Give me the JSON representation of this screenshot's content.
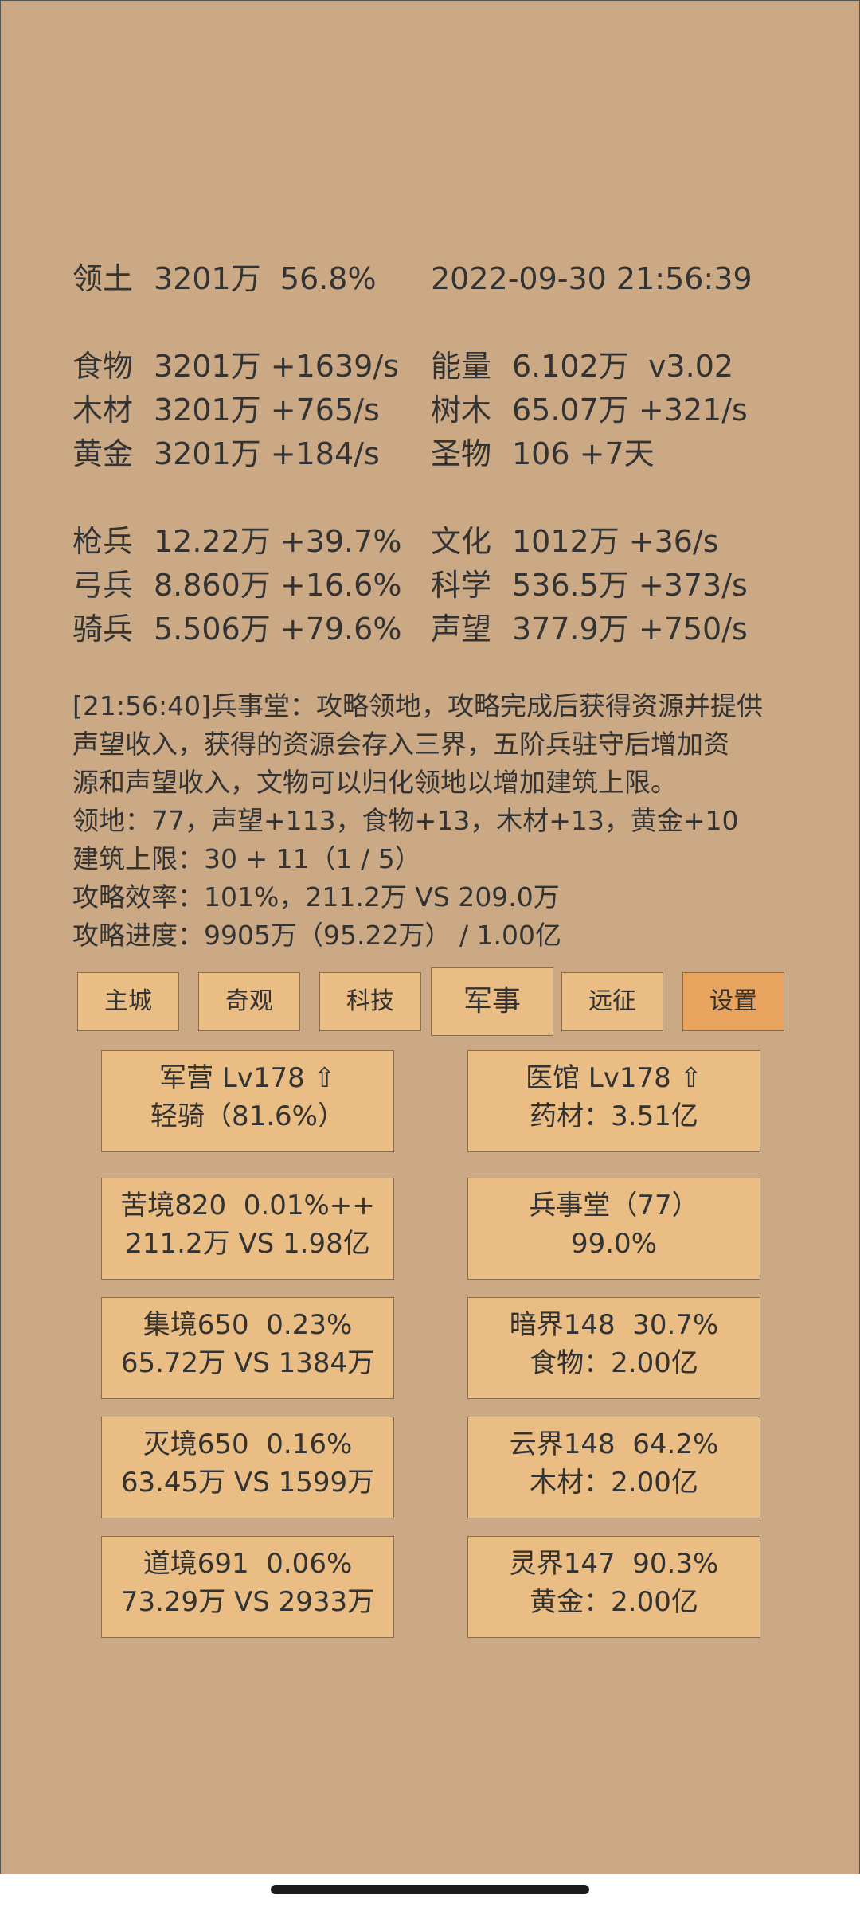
{
  "stats": {
    "territory": {
      "label": "领土",
      "value": "3201万  56.8%"
    },
    "datetime": "2022-09-30 21:56:39",
    "food": {
      "label": "食物",
      "value": "3201万 +1639/s"
    },
    "energy": {
      "label": "能量",
      "value": "6.102万  v3.02"
    },
    "wood": {
      "label": "木材",
      "value": "3201万 +765/s"
    },
    "tree": {
      "label": "树木",
      "value": "65.07万 +321/s"
    },
    "gold": {
      "label": "黄金",
      "value": "3201万 +184/s"
    },
    "relic": {
      "label": "圣物",
      "value": "106 +7天"
    },
    "spearman": {
      "label": "枪兵",
      "value": "12.22万 +39.7%"
    },
    "culture": {
      "label": "文化",
      "value": "1012万 +36/s"
    },
    "archer": {
      "label": "弓兵",
      "value": "8.860万 +16.6%"
    },
    "science": {
      "label": "科学",
      "value": "536.5万 +373/s"
    },
    "cavalry": {
      "label": "骑兵",
      "value": "5.506万 +79.6%"
    },
    "prestige": {
      "label": "声望",
      "value": "377.9万 +750/s"
    }
  },
  "log": {
    "line1": "[21:56:40]兵事堂：攻略领地，攻略完成后获得资源并提供",
    "line2": "声望收入，获得的资源会存入三界，五阶兵驻守后增加资",
    "line3": "源和声望收入，文物可以归化领地以增加建筑上限。",
    "line4": "领地：77，声望+113，食物+13，木材+13，黄金+10",
    "line5": "建筑上限：30 + 11（1 / 5）",
    "line6": "攻略效率：101%，211.2万 VS 209.0万",
    "line7": "攻略进度：9905万（95.22万） / 1.00亿"
  },
  "tabs": {
    "main_city": "主城",
    "wonders": "奇观",
    "tech": "科技",
    "military": "军事",
    "expedition": "远征",
    "settings": "设置",
    "active": "军事"
  },
  "cards": {
    "barracks": {
      "l1": "军营 Lv178 ⇧",
      "l2": "轻骑（81.6%）"
    },
    "clinic": {
      "l1": "医馆 Lv178 ⇧",
      "l2": "药材：3.51亿"
    },
    "kujing": {
      "l1": "苦境820  0.01%++",
      "l2": "211.2万 VS 1.98亿"
    },
    "bingshitang": {
      "l1": "兵事堂（77）",
      "l2": "99.0%"
    },
    "jijing": {
      "l1": "集境650  0.23%",
      "l2": "65.72万 VS 1384万"
    },
    "anjie": {
      "l1": "暗界148  30.7%",
      "l2": "食物：2.00亿"
    },
    "miejing": {
      "l1": "灭境650  0.16%",
      "l2": "63.45万 VS 1599万"
    },
    "yunjie": {
      "l1": "云界148  64.2%",
      "l2": "木材：2.00亿"
    },
    "daojing": {
      "l1": "道境691  0.06%",
      "l2": "73.29万 VS 2933万"
    },
    "lingjie": {
      "l1": "灵界147  90.3%",
      "l2": "黄金：2.00亿"
    }
  },
  "colors": {
    "background": "#cba985",
    "button": "#e9bd83",
    "settings_button": "#e9a45f",
    "text": "#333333"
  }
}
